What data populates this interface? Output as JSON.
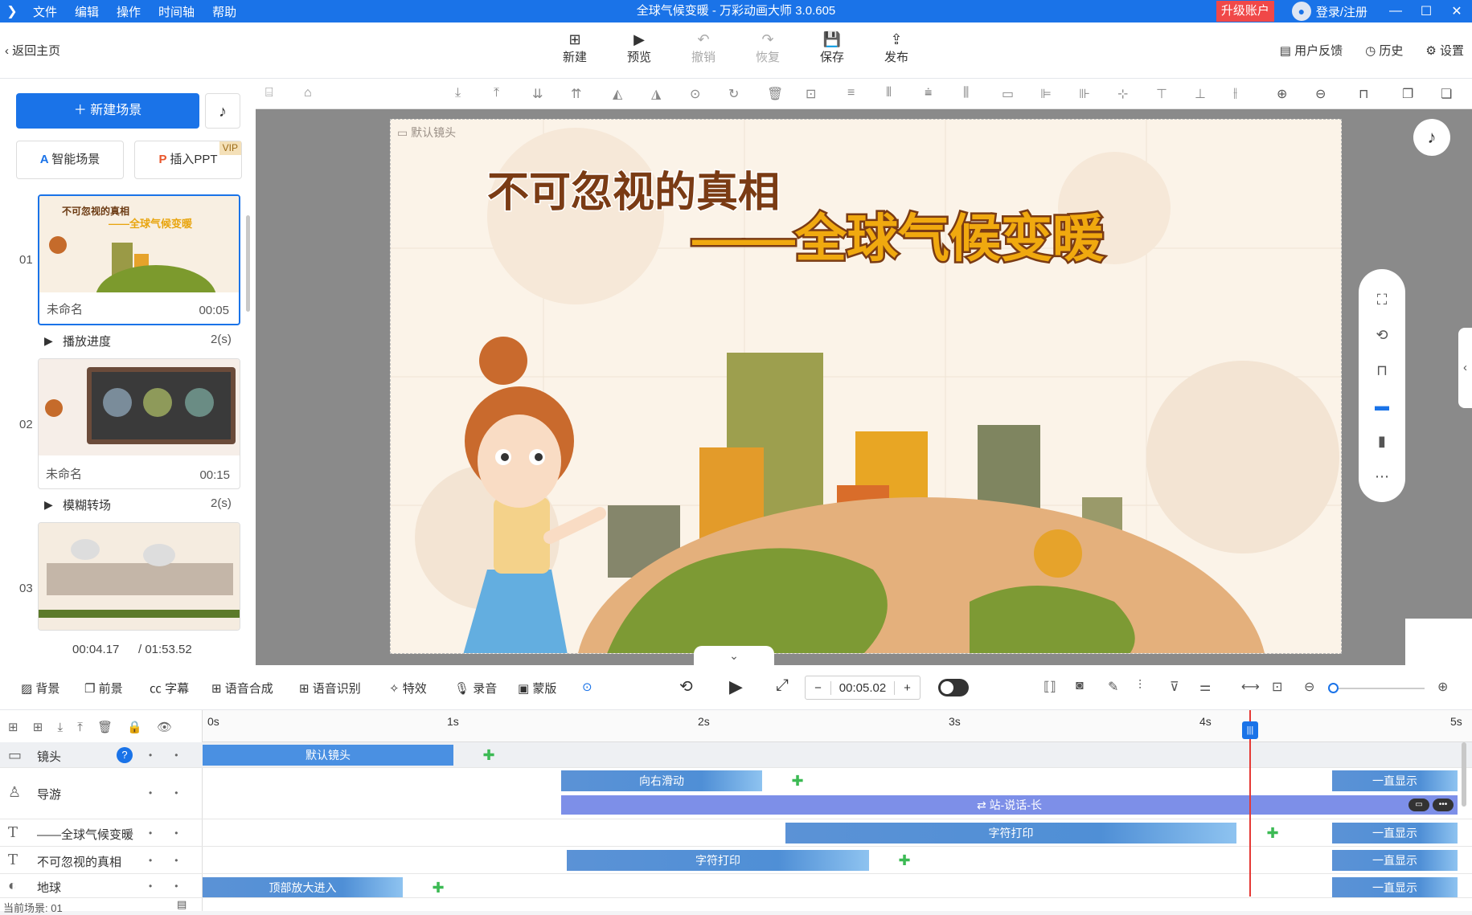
{
  "titlebar": {
    "logo": "❯",
    "menus": [
      "文件",
      "编辑",
      "操作",
      "时间轴",
      "帮助"
    ],
    "title": "全球气候变暖 - 万彩动画大师 3.0.605",
    "upgrade": "升级账户",
    "login": "登录/注册",
    "min": "—",
    "max": "☐",
    "close": "✕"
  },
  "toolbar": {
    "back": "返回主页",
    "buttons": [
      {
        "icon": "⊞",
        "label": "新建"
      },
      {
        "icon": "▶",
        "label": "预览"
      },
      {
        "icon": "↶",
        "label": "撤销"
      },
      {
        "icon": "↷",
        "label": "恢复"
      },
      {
        "icon": "💾",
        "label": "保存"
      },
      {
        "icon": "⇪",
        "label": "发布"
      }
    ],
    "feedback": "用户反馈",
    "history": "历史",
    "settings": "设置"
  },
  "left": {
    "new_scene": "＋ 新建场景",
    "music_icon": "♪",
    "smart": "智能场景",
    "ppt": "插入PPT",
    "vip": "VIP",
    "scenes": [
      {
        "num": "01",
        "name": "未命名",
        "dur": "00:05",
        "thumb_title": "不可忽视的真相",
        "thumb_sub": "——全球气候变暖"
      },
      {
        "num": "02",
        "name": "未命名",
        "dur": "00:15"
      },
      {
        "num": "03"
      }
    ],
    "transitions": [
      {
        "name": "播放进度",
        "dur": "2(s)"
      },
      {
        "name": "模糊转场",
        "dur": "2(s)"
      }
    ],
    "time_current": "00:04.17",
    "time_total": "/ 01:53.52"
  },
  "stage": {
    "camera_label": "默认镜头",
    "title1": "不可忽视的真相",
    "title2": "——全球气候变暖"
  },
  "timeline_toolbar": {
    "items": [
      "背景",
      "前景",
      "字幕",
      "语音合成",
      "语音识别",
      "特效",
      "录音",
      "蒙版"
    ],
    "time": "00:05.02",
    "minus": "−",
    "plus": "+"
  },
  "timeline": {
    "ticks": [
      "0s",
      "1s",
      "2s",
      "3s",
      "4s",
      "5s"
    ],
    "rows": [
      {
        "name": "镜头",
        "icon": "▭"
      },
      {
        "name": "导游",
        "icon": "♙"
      },
      {
        "name": "——全球气候变暖",
        "icon": "T"
      },
      {
        "name": "不可忽视的真相",
        "icon": "T"
      },
      {
        "name": "地球",
        "icon": "◐"
      }
    ],
    "clips": {
      "camera": "默认镜头",
      "guide1": "向右滑动",
      "guide2": "⇄ 站-说话-长",
      "text_a": "字符打印",
      "text_b": "字符打印",
      "earth": "顶部放大进入",
      "always": "一直显示"
    },
    "footer": "当前场景: 01",
    "help": "?"
  },
  "colors": {
    "accent": "#1a73e8",
    "upgrade": "#f04848",
    "keyframe": "#3cba54",
    "playhead": "#e53935"
  }
}
